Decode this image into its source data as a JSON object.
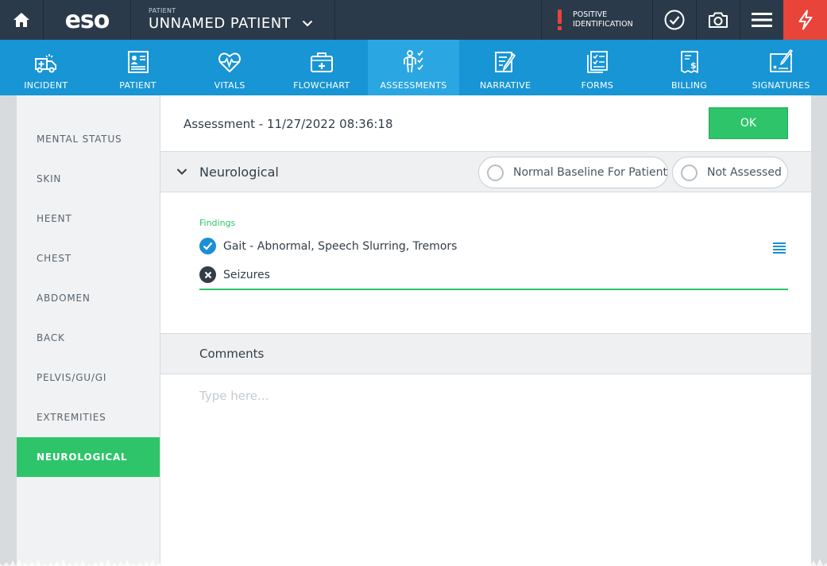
{
  "header": {
    "logo": "eso",
    "patient_label": "PATIENT",
    "patient_name": "UNNAMED PATIENT",
    "positive_id_line1": "POSITIVE",
    "positive_id_line2": "IDENTIFICATION",
    "colors": {
      "bar": "#2b3a4a",
      "alert": "#e8443a"
    },
    "icons": [
      "home-icon",
      "chevron-down-icon",
      "alert-icon",
      "check-circle-icon",
      "camera-icon",
      "hamburger-menu-icon",
      "bolt-icon"
    ]
  },
  "nav": {
    "items": [
      {
        "label": "INCIDENT",
        "icon": "ambulance-icon"
      },
      {
        "label": "PATIENT",
        "icon": "patient-card-icon"
      },
      {
        "label": "VITALS",
        "icon": "heart-pulse-icon"
      },
      {
        "label": "FLOWCHART",
        "icon": "medical-bag-icon"
      },
      {
        "label": "ASSESSMENTS",
        "icon": "body-check-icon"
      },
      {
        "label": "NARRATIVE",
        "icon": "pencil-doc-icon"
      },
      {
        "label": "FORMS",
        "icon": "checklist-icon"
      },
      {
        "label": "BILLING",
        "icon": "invoice-icon"
      },
      {
        "label": "SIGNATURES",
        "icon": "signature-icon"
      }
    ],
    "active": "ASSESSMENTS",
    "colors": {
      "bar": "#1795d4",
      "active": "#2aa6e2"
    }
  },
  "sidebar": {
    "items": [
      {
        "label": "MENTAL STATUS"
      },
      {
        "label": "SKIN"
      },
      {
        "label": "HEENT"
      },
      {
        "label": "CHEST"
      },
      {
        "label": "ABDOMEN"
      },
      {
        "label": "BACK"
      },
      {
        "label": "PELVIS/GU/GI"
      },
      {
        "label": "EXTREMITIES"
      },
      {
        "label": "NEUROLOGICAL"
      }
    ],
    "active": "NEUROLOGICAL",
    "active_color": "#2ec56a"
  },
  "assessment": {
    "title": "Assessment - 11/27/2022 08:36:18",
    "ok_label": "OK",
    "section_title": "Neurological",
    "normal_baseline_label": "Normal Baseline For Patient",
    "not_assessed_label": "Not Assessed",
    "findings_label": "Findings",
    "findings": [
      {
        "text": "Gait - Abnormal, Speech Slurring, Tremors",
        "state": "checked"
      },
      {
        "text": "Seizures",
        "state": "excluded"
      }
    ],
    "comments_title": "Comments",
    "comments_placeholder": "Type here...",
    "comments_value": ""
  }
}
